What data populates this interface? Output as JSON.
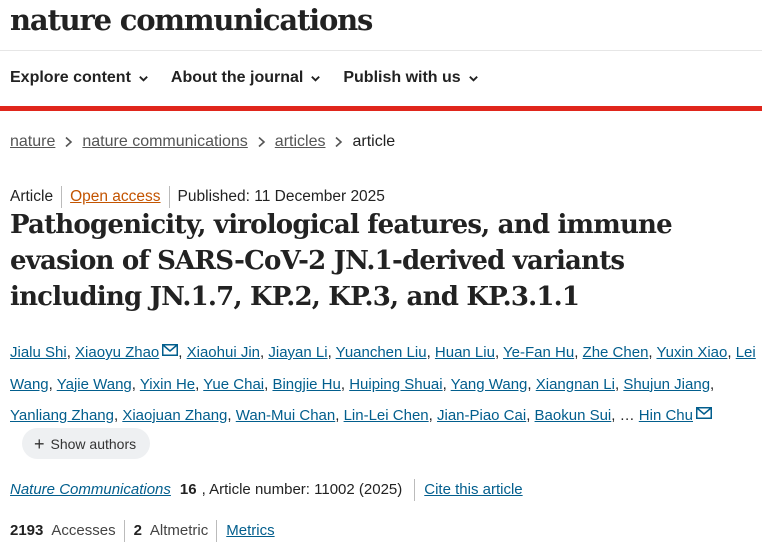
{
  "masthead": {
    "logo_text": "nature communications"
  },
  "nav": {
    "items": [
      {
        "label": "Explore content"
      },
      {
        "label": "About the journal"
      },
      {
        "label": "Publish with us"
      }
    ]
  },
  "breadcrumb": {
    "items": [
      "nature",
      "nature communications",
      "articles"
    ],
    "current": "article"
  },
  "article_meta": {
    "type": "Article",
    "access": "Open access",
    "published": "Published: 11 December 2025"
  },
  "title": "Pathogenicity, virological features, and immune evasion of SARS-CoV-2 JN.1-derived variants including JN.1.7, KP.2, KP.3, and KP.3.1.1",
  "authors": {
    "list": [
      "Jialu Shi",
      "Xiaoyu Zhao",
      "Xiaohui Jin",
      "Jiayan Li",
      "Yuanchen Liu",
      "Huan Liu",
      "Ye-Fan Hu",
      "Zhe Chen",
      "Yuxin Xiao",
      "Lei Wang",
      "Yajie Wang",
      "Yixin He",
      "Yue Chai",
      "Bingjie Hu",
      "Huiping Shuai",
      "Yang Wang",
      "Xiangnan Li",
      "Shujun Jiang",
      "Yanliang Zhang",
      "Xiaojuan Zhang",
      "Wan-Mui Chan",
      "Lin-Lei Chen",
      "Jian-Piao Cai",
      "Baokun Sui"
    ],
    "ellipsis": "…",
    "last_author": "Hin Chu",
    "show_authors_label": "Show authors"
  },
  "citation": {
    "journal": "Nature Communications",
    "volume": "16",
    "article_number": ", Article number: 11002 (2025)",
    "cite_label": "Cite this article"
  },
  "metrics": {
    "accesses_count": "2193",
    "accesses_label": "Accesses",
    "altmetric_count": "2",
    "altmetric_label": "Altmetric",
    "metrics_link": "Metrics"
  },
  "colors": {
    "accent_red": "#e0261c",
    "link_blue": "#025e8d",
    "open_access_orange": "#c35400"
  }
}
